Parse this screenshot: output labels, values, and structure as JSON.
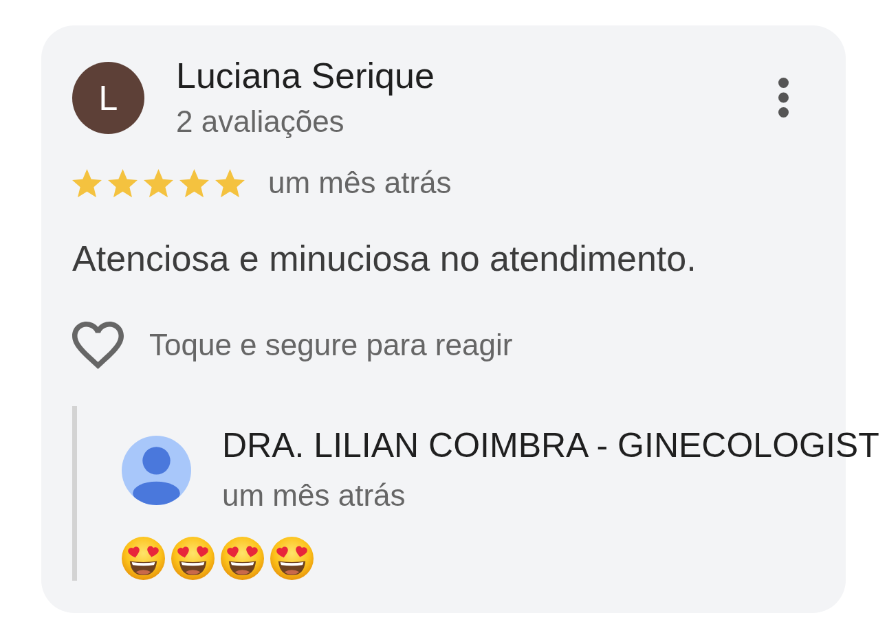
{
  "review": {
    "author": {
      "initial": "L",
      "name": "Luciana Serique",
      "review_count": "2 avaliações"
    },
    "stars": 5,
    "time": "um mês atrás",
    "text": "Atenciosa e minuciosa no atendimento.",
    "reaction_hint": "Toque e segure para reagir",
    "owner_reply": {
      "name": "DRA. LILIAN COIMBRA - GINECOLOGIST",
      "time": "um mês atrás",
      "emojis": [
        {
          "kind": "heart-eyes"
        },
        {
          "kind": "heart-eyes"
        },
        {
          "kind": "heart-eyes"
        },
        {
          "kind": "heart-eyes"
        }
      ]
    }
  }
}
